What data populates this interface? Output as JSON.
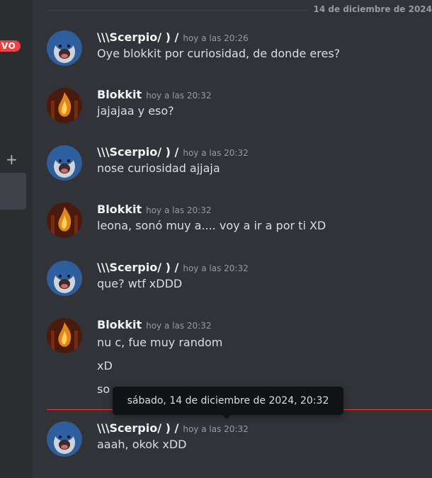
{
  "sidebar": {
    "new_badge": "VO",
    "plus": "+"
  },
  "date_divider": "14 de diciembre de 2024",
  "messages": [
    {
      "author": "\\\\\\Scerpio/ ) /",
      "time": "hoy a las 20:26",
      "avatar": "gorilla-avatar",
      "lines": [
        "Oye blokkit por curiosidad, de donde eres?"
      ]
    },
    {
      "author": "Blokkit",
      "time": "hoy a las 20:32",
      "avatar": "fire-avatar",
      "lines": [
        "jajajaa y eso?"
      ]
    },
    {
      "author": "\\\\\\Scerpio/ ) /",
      "time": "hoy a las 20:32",
      "avatar": "gorilla-avatar",
      "lines": [
        "nose curiosidad ajjaja"
      ]
    },
    {
      "author": "Blokkit",
      "time": "hoy a las 20:32",
      "avatar": "fire-avatar",
      "lines": [
        "leona, sonó muy a.... voy a ir a por ti XD"
      ]
    },
    {
      "author": "\\\\\\Scerpio/ ) /",
      "time": "hoy a las 20:32",
      "avatar": "gorilla-avatar",
      "lines": [
        "que? wtf xDDD"
      ]
    },
    {
      "author": "Blokkit",
      "time": "hoy a las 20:32",
      "avatar": "fire-avatar",
      "lines": [
        "nu c, fue muy random",
        "xD",
        "so"
      ]
    },
    {
      "author": "\\\\\\Scerpio/ ) /",
      "time": "hoy a las 20:32",
      "avatar": "gorilla-avatar",
      "lines": [
        "aaah, okok xDD"
      ]
    }
  ],
  "tooltip": "sábado, 14 de diciembre de 2024, 20:32"
}
